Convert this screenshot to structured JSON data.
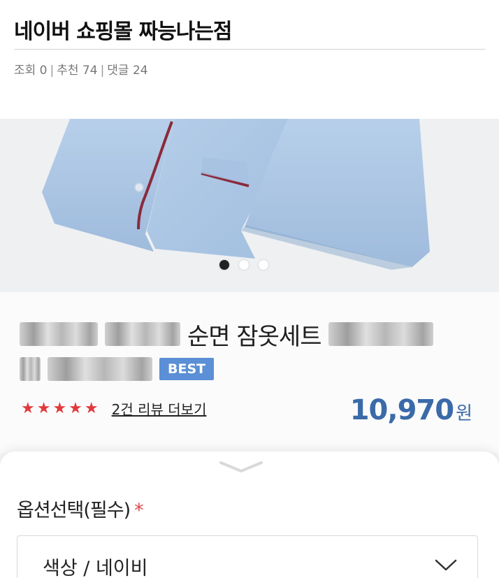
{
  "post": {
    "title": "네이버 쇼핑몰 짜능나는점",
    "views_label": "조회 0",
    "recommend_label": "추천 74",
    "comments_label": "댓글 24",
    "separator": "|"
  },
  "product": {
    "name_visible": "순면 잠옷세트",
    "badge": "BEST",
    "stars": "★★★★★",
    "rating_stars": 5,
    "review_link": "2건 리뷰 더보기",
    "price": "10,970",
    "price_unit": "원",
    "carousel": {
      "slides": 3,
      "active_slide": 1
    }
  },
  "options": {
    "label": "옵션선택(필수)",
    "required_mark": "*",
    "selected_value": "색상 / 네이비"
  },
  "colors": {
    "price": "#3a6aa8",
    "badge": "#5b8fd6",
    "stars": "#e03a3e",
    "required": "#e04848",
    "garment": "#a9c4e4",
    "piping": "#8a2a3a"
  }
}
